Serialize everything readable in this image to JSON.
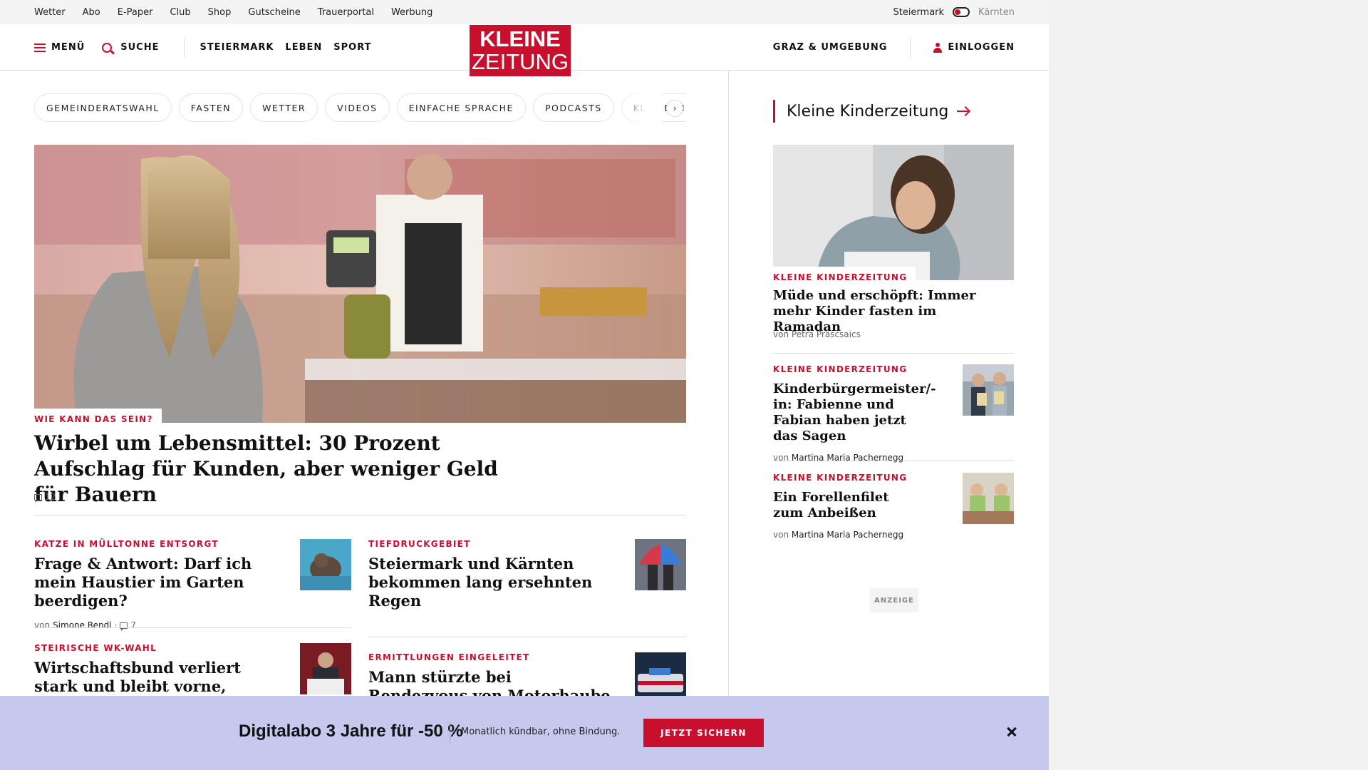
{
  "utility_links": [
    "Wetter",
    "Abo",
    "E-Paper",
    "Club",
    "Shop",
    "Gutscheine",
    "Trauerportal",
    "Werbung"
  ],
  "region": {
    "active": "Steiermark",
    "inactive": "Kärnten"
  },
  "header": {
    "menu": "MENÜ",
    "search": "SUCHE",
    "sections": [
      "STEIERMARK",
      "LEBEN",
      "SPORT"
    ],
    "logo_line1": "KLEINE",
    "logo_line2": "ZEITUNG",
    "location": "GRAZ & UMGEBUNG",
    "login": "EINLOGGEN"
  },
  "chips": [
    "GEMEINDERATSWAHL",
    "FASTEN",
    "WETTER",
    "VIDEOS",
    "EINFACHE SPRACHE",
    "PODCASTS",
    "KLEINE KINDERZEITUNG"
  ],
  "hero": {
    "kicker": "WIE KANN DAS SEIN?",
    "title": "Wirbel um Lebensmittel: 30 Prozent Aufschlag für Kunden, aber weniger Geld für Bauern",
    "comments": "12"
  },
  "articles": [
    {
      "kicker": "KATZE IN MÜLLTONNE ENTSORGT",
      "title": "Frage & Antwort: Darf ich mein Haustier im Garten beerdigen?",
      "by": "von",
      "author": "Simone Rendl",
      "comments": "7"
    },
    {
      "kicker": "TIEFDRUCKGEBIET",
      "title": "Steiermark und Kärnten bekommen lang ersehnten Regen"
    },
    {
      "kicker": "STEIRISCHE WK-WAHL",
      "title": "Wirtschaftsbund verliert stark und bleibt vorne,"
    },
    {
      "kicker": "ERMITTLUNGEN EINGELEITET",
      "title": "Mann stürzte bei Rendezvous von Motorhaube und starb"
    }
  ],
  "sidebar": {
    "heading": "Kleine Kinderzeitung",
    "main": {
      "kicker": "KLEINE KINDERZEITUNG",
      "title": "Müde und erschöpft: Immer mehr Kinder fasten im Ramadan",
      "by": "von",
      "author": "Petra Prascsaics"
    },
    "items": [
      {
        "kicker": "KLEINE KINDERZEITUNG",
        "title": "Kinderbürgermeister/-in: Fabienne und Fabian haben jetzt das Sagen",
        "by": "von",
        "author": "Martina Maria Pachernegg"
      },
      {
        "kicker": "KLEINE KINDERZEITUNG",
        "title": "Ein Forellenfilet zum Anbeißen",
        "by": "von",
        "author": "Martina Maria Pachernegg"
      }
    ],
    "ad_label": "ANZEIGE"
  },
  "promo": {
    "title": "Digitalabo 3 Jahre für -50 %",
    "subtitle": "Monatlich kündbar, ohne Bindung.",
    "button": "JETZT SICHERN"
  },
  "colors": {
    "brand_red": "#c8102e",
    "promo_bg": "#c5c9ee"
  }
}
